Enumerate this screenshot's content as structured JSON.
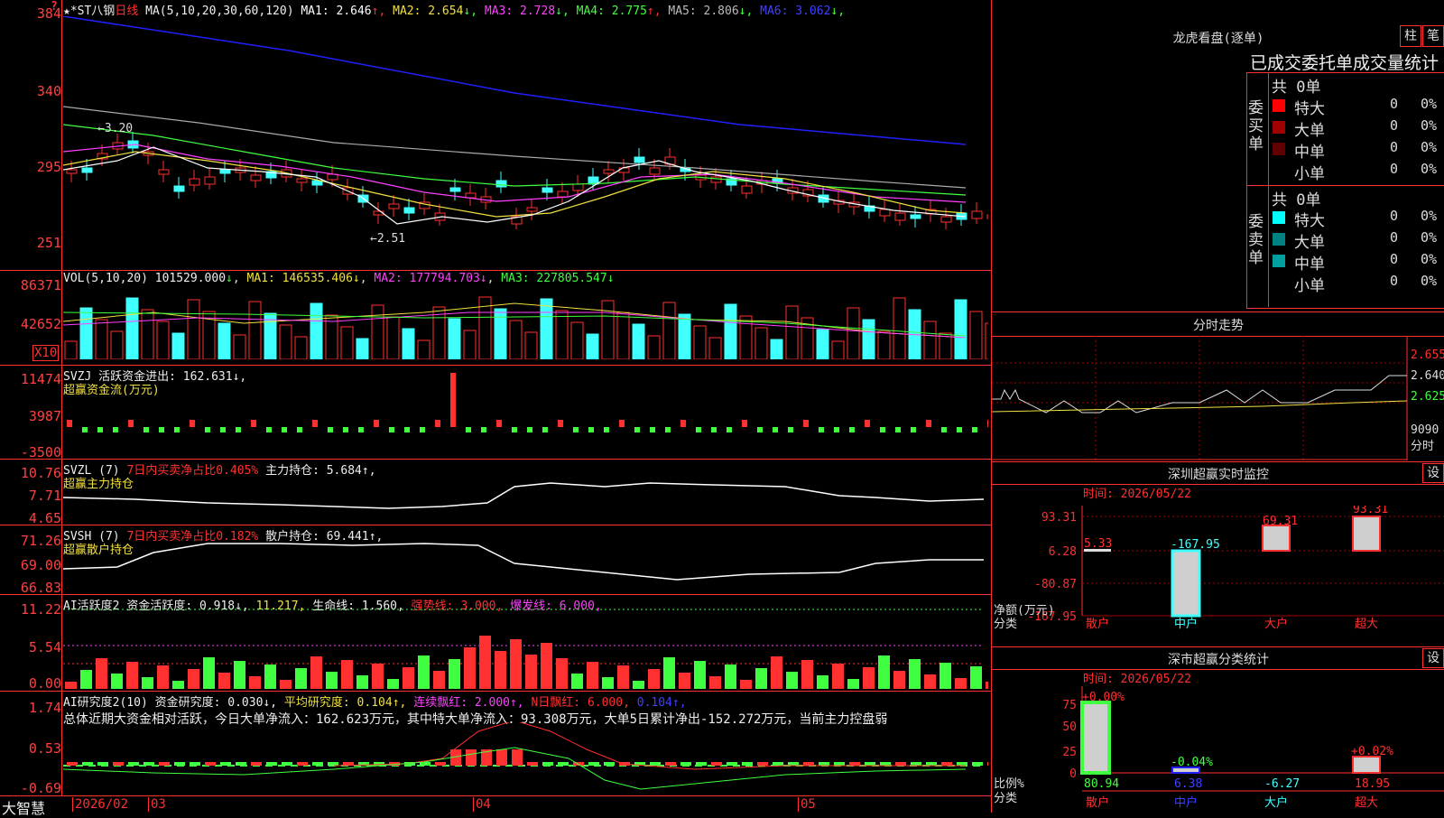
{
  "header": {
    "stock": "★*ST八钢",
    "period": "日线",
    "ma_label": "MA(5,10,20,30,60,120)",
    "ma": [
      {
        "label": "MA1:",
        "value": "2.646",
        "arrow": "↑",
        "color": "#ffffff"
      },
      {
        "label": "MA2:",
        "value": "2.654",
        "arrow": "↓",
        "color": "#f0e040"
      },
      {
        "label": "MA3:",
        "value": "2.728",
        "arrow": "↓",
        "color": "#ff40ff"
      },
      {
        "label": "MA4:",
        "value": "2.775",
        "arrow": "↑",
        "color": "#40ff40"
      },
      {
        "label": "MA5:",
        "value": "2.806",
        "arrow": "↓",
        "color": "#bbbbbb"
      },
      {
        "label": "MA6:",
        "value": "3.062",
        "arrow": "↓",
        "color": "#4040ff"
      }
    ]
  },
  "axes": {
    "price": [
      "384",
      "340",
      "295",
      "251"
    ],
    "volume": [
      "86371",
      "42652"
    ],
    "svzj": [
      "11474",
      "3987",
      "-3500"
    ],
    "svzl": [
      "10.76",
      "7.71",
      "4.65"
    ],
    "svsh": [
      "71.26",
      "69.00",
      "66.83"
    ],
    "ai1": [
      "11.22",
      "5.54",
      "0.00"
    ],
    "ai2": [
      "1.74",
      "0.53",
      "-0.69"
    ],
    "x10": "X10"
  },
  "annotations": {
    "high": "←3.20",
    "low": "←2.51"
  },
  "vol_legend": {
    "name": "VOL(5,10,20)",
    "v": "101529.000",
    "a1": "↓",
    "ma1": "MA1: 146535.406↓",
    "ma2": "MA2: 177794.703↓",
    "ma3": "MA3: 227805.547↓"
  },
  "svzj_legend": {
    "name": "SVZJ",
    "text": "活跃资金进出: 162.631↓,",
    "sub": "超赢资金流(万元)"
  },
  "svzl_legend": {
    "name": "SVZL (7)",
    "t1": "7日内买卖净占比0.405%",
    "t2": "主力持仓: 5.684↑,",
    "sub": "超赢主力持仓"
  },
  "svsh_legend": {
    "name": "SVSH (7)",
    "t1": "7日内买卖净占比0.182%",
    "t2": "散户持仓: 69.441↑,",
    "sub": "超赢散户持仓"
  },
  "ai1_legend": {
    "name": "AI活跃度2",
    "t1": "资金活跃度: 0.918↓,",
    "t2": "11.217,",
    "t3": "生命线: 1.560,",
    "t4": "强势线: 3.000,",
    "t5": "爆发线: 6.000,"
  },
  "ai2_legend": {
    "name": "AI研究度2(10)",
    "t1": "资金研究度: 0.030↓,",
    "t2": "平均研究度: 0.104↑,",
    "t3": "连续飘红: 2.000↑,",
    "t4": "N日飘红: 6.000,",
    "t5": "0.104↑,"
  },
  "summary": "总体近期大资金相对活跃，今日大单净流入：162.623万元，其中特大单净流入：93.308万元，大单5日累计净出-152.272万元，当前主力控盘弱",
  "xaxis": {
    "brand": "大智慧",
    "d1": "2026/02",
    "d2": "03",
    "d3": "04",
    "d4": "05"
  },
  "dragon": {
    "title": "龙虎看盘(逐单)",
    "btn1": "柱",
    "btn2": "笔",
    "subtitle": "已成交委托单成交量统计",
    "buy_label": "委买单",
    "sell_label": "委卖单",
    "buy_total": "共 0单",
    "sell_total": "共 0单",
    "buy_rows": [
      {
        "name": "特大",
        "count": "0",
        "pct": "0%",
        "color": "#ff0000"
      },
      {
        "name": "大单",
        "count": "0",
        "pct": "0%",
        "color": "#a00000"
      },
      {
        "name": "中单",
        "count": "0",
        "pct": "0%",
        "color": "#600000"
      },
      {
        "name": "小单",
        "count": "0",
        "pct": "0%",
        "color": "#000000"
      }
    ],
    "sell_rows": [
      {
        "name": "特大",
        "count": "0",
        "pct": "0%",
        "color": "#00ffff"
      },
      {
        "name": "大单",
        "count": "0",
        "pct": "0%",
        "color": "#008080"
      },
      {
        "name": "中单",
        "count": "0",
        "pct": "0%",
        "color": "#00a0a0"
      },
      {
        "name": "小单",
        "count": "0",
        "pct": "0%",
        "color": "#000000"
      }
    ]
  },
  "intraday": {
    "title": "分时走势",
    "p1": "2.655",
    "p2": "2.640",
    "p3": "2.625",
    "vol": "9090",
    "unit": "分时"
  },
  "monitor": {
    "title": "深圳超赢实时监控",
    "btn": "设",
    "time": "时间: 2026/05/22",
    "ylabels": [
      "93.31",
      "6.28",
      "-80.87",
      "-167.95"
    ],
    "bottom": "净额(万元)",
    "cat": "分类",
    "bars": [
      {
        "name": "散户",
        "value": "5.33"
      },
      {
        "name": "中户",
        "value": "-167.95"
      },
      {
        "name": "大户",
        "value": "69.31"
      },
      {
        "name": "超大",
        "value": "93.31"
      }
    ]
  },
  "classify": {
    "title": "深市超赢分类统计",
    "btn": "设",
    "time": "时间: 2026/05/22",
    "ylabels": [
      "75",
      "50",
      "25",
      "0"
    ],
    "bottom": "比例%",
    "cat": "分类",
    "bars": [
      {
        "name": "散户",
        "pct": "+0.00%",
        "value": "80.94"
      },
      {
        "name": "中户",
        "pct": "-0.04%",
        "value": "6.38"
      },
      {
        "name": "大户",
        "pct": "",
        "value": "-6.27"
      },
      {
        "name": "超大",
        "pct": "+0.02%",
        "value": "18.95"
      }
    ]
  }
}
